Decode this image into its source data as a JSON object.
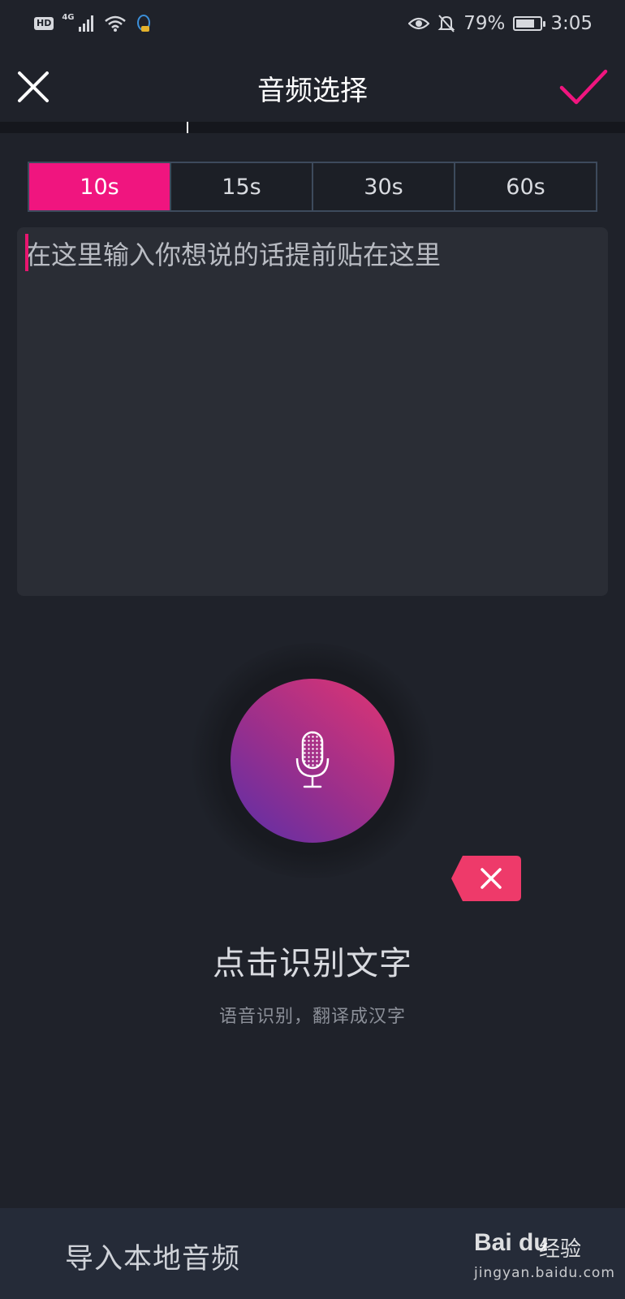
{
  "status_bar": {
    "hd": "HD",
    "network": "4G",
    "battery": "79%",
    "battery_level": 0.79,
    "time": "3:05"
  },
  "header": {
    "title": "音频选择",
    "accent_color": "#f0157f"
  },
  "duration_tabs": {
    "selected": "10s",
    "items": [
      {
        "label": "10s"
      },
      {
        "label": "15s"
      },
      {
        "label": "30s"
      },
      {
        "label": "60s"
      }
    ]
  },
  "text_input": {
    "placeholder": "在这里输入你想说的话提前贴在这里"
  },
  "recognition": {
    "title": "点击识别文字",
    "subtitle": "语音识别，翻译成汉字"
  },
  "bottom_bar": {
    "import_label": "导入本地音频"
  },
  "watermark": {
    "brand": "Bai du",
    "brand_cn": "经验",
    "url": "jingyan.baidu.com"
  }
}
